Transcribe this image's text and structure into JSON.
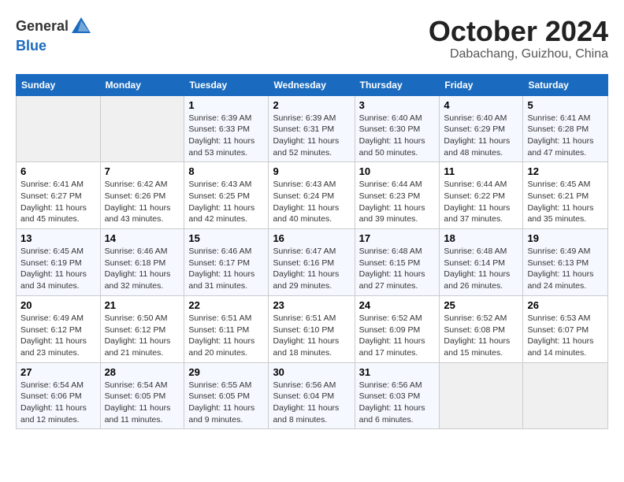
{
  "header": {
    "logo_line1": "General",
    "logo_line2": "Blue",
    "month": "October 2024",
    "location": "Dabachang, Guizhou, China"
  },
  "weekdays": [
    "Sunday",
    "Monday",
    "Tuesday",
    "Wednesday",
    "Thursday",
    "Friday",
    "Saturday"
  ],
  "weeks": [
    [
      {
        "num": "",
        "info": ""
      },
      {
        "num": "",
        "info": ""
      },
      {
        "num": "1",
        "info": "Sunrise: 6:39 AM\nSunset: 6:33 PM\nDaylight: 11 hours and 53 minutes."
      },
      {
        "num": "2",
        "info": "Sunrise: 6:39 AM\nSunset: 6:31 PM\nDaylight: 11 hours and 52 minutes."
      },
      {
        "num": "3",
        "info": "Sunrise: 6:40 AM\nSunset: 6:30 PM\nDaylight: 11 hours and 50 minutes."
      },
      {
        "num": "4",
        "info": "Sunrise: 6:40 AM\nSunset: 6:29 PM\nDaylight: 11 hours and 48 minutes."
      },
      {
        "num": "5",
        "info": "Sunrise: 6:41 AM\nSunset: 6:28 PM\nDaylight: 11 hours and 47 minutes."
      }
    ],
    [
      {
        "num": "6",
        "info": "Sunrise: 6:41 AM\nSunset: 6:27 PM\nDaylight: 11 hours and 45 minutes."
      },
      {
        "num": "7",
        "info": "Sunrise: 6:42 AM\nSunset: 6:26 PM\nDaylight: 11 hours and 43 minutes."
      },
      {
        "num": "8",
        "info": "Sunrise: 6:43 AM\nSunset: 6:25 PM\nDaylight: 11 hours and 42 minutes."
      },
      {
        "num": "9",
        "info": "Sunrise: 6:43 AM\nSunset: 6:24 PM\nDaylight: 11 hours and 40 minutes."
      },
      {
        "num": "10",
        "info": "Sunrise: 6:44 AM\nSunset: 6:23 PM\nDaylight: 11 hours and 39 minutes."
      },
      {
        "num": "11",
        "info": "Sunrise: 6:44 AM\nSunset: 6:22 PM\nDaylight: 11 hours and 37 minutes."
      },
      {
        "num": "12",
        "info": "Sunrise: 6:45 AM\nSunset: 6:21 PM\nDaylight: 11 hours and 35 minutes."
      }
    ],
    [
      {
        "num": "13",
        "info": "Sunrise: 6:45 AM\nSunset: 6:19 PM\nDaylight: 11 hours and 34 minutes."
      },
      {
        "num": "14",
        "info": "Sunrise: 6:46 AM\nSunset: 6:18 PM\nDaylight: 11 hours and 32 minutes."
      },
      {
        "num": "15",
        "info": "Sunrise: 6:46 AM\nSunset: 6:17 PM\nDaylight: 11 hours and 31 minutes."
      },
      {
        "num": "16",
        "info": "Sunrise: 6:47 AM\nSunset: 6:16 PM\nDaylight: 11 hours and 29 minutes."
      },
      {
        "num": "17",
        "info": "Sunrise: 6:48 AM\nSunset: 6:15 PM\nDaylight: 11 hours and 27 minutes."
      },
      {
        "num": "18",
        "info": "Sunrise: 6:48 AM\nSunset: 6:14 PM\nDaylight: 11 hours and 26 minutes."
      },
      {
        "num": "19",
        "info": "Sunrise: 6:49 AM\nSunset: 6:13 PM\nDaylight: 11 hours and 24 minutes."
      }
    ],
    [
      {
        "num": "20",
        "info": "Sunrise: 6:49 AM\nSunset: 6:12 PM\nDaylight: 11 hours and 23 minutes."
      },
      {
        "num": "21",
        "info": "Sunrise: 6:50 AM\nSunset: 6:12 PM\nDaylight: 11 hours and 21 minutes."
      },
      {
        "num": "22",
        "info": "Sunrise: 6:51 AM\nSunset: 6:11 PM\nDaylight: 11 hours and 20 minutes."
      },
      {
        "num": "23",
        "info": "Sunrise: 6:51 AM\nSunset: 6:10 PM\nDaylight: 11 hours and 18 minutes."
      },
      {
        "num": "24",
        "info": "Sunrise: 6:52 AM\nSunset: 6:09 PM\nDaylight: 11 hours and 17 minutes."
      },
      {
        "num": "25",
        "info": "Sunrise: 6:52 AM\nSunset: 6:08 PM\nDaylight: 11 hours and 15 minutes."
      },
      {
        "num": "26",
        "info": "Sunrise: 6:53 AM\nSunset: 6:07 PM\nDaylight: 11 hours and 14 minutes."
      }
    ],
    [
      {
        "num": "27",
        "info": "Sunrise: 6:54 AM\nSunset: 6:06 PM\nDaylight: 11 hours and 12 minutes."
      },
      {
        "num": "28",
        "info": "Sunrise: 6:54 AM\nSunset: 6:05 PM\nDaylight: 11 hours and 11 minutes."
      },
      {
        "num": "29",
        "info": "Sunrise: 6:55 AM\nSunset: 6:05 PM\nDaylight: 11 hours and 9 minutes."
      },
      {
        "num": "30",
        "info": "Sunrise: 6:56 AM\nSunset: 6:04 PM\nDaylight: 11 hours and 8 minutes."
      },
      {
        "num": "31",
        "info": "Sunrise: 6:56 AM\nSunset: 6:03 PM\nDaylight: 11 hours and 6 minutes."
      },
      {
        "num": "",
        "info": ""
      },
      {
        "num": "",
        "info": ""
      }
    ]
  ]
}
